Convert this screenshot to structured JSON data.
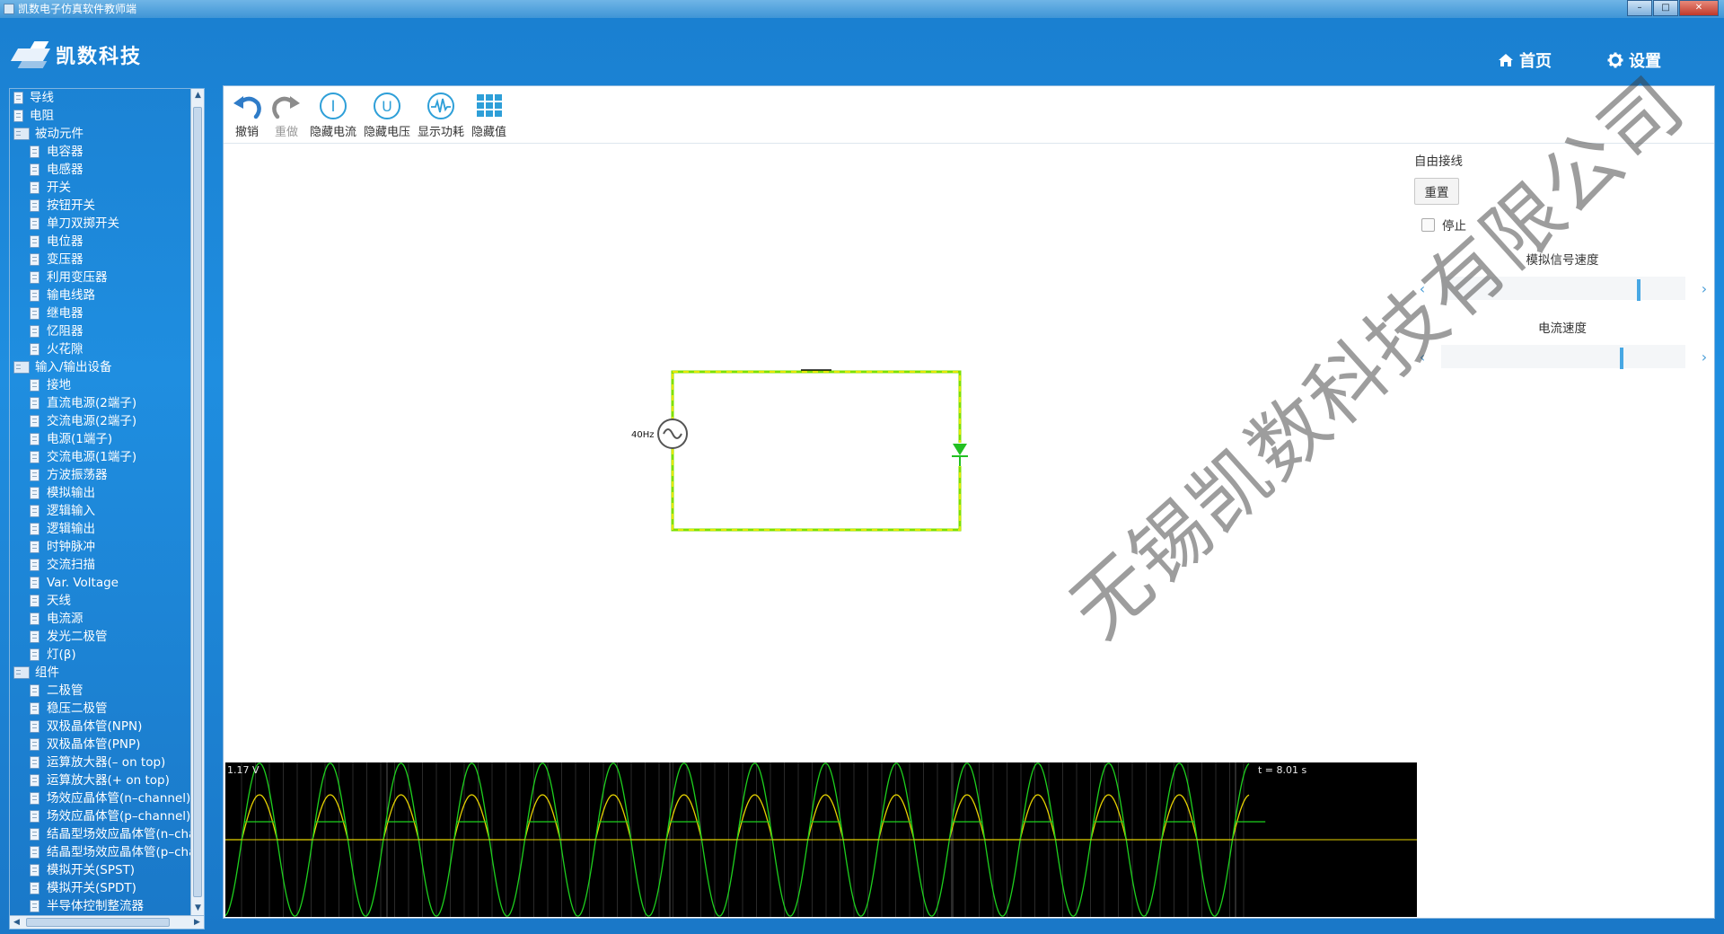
{
  "window": {
    "title": "凯数电子仿真软件教师端",
    "btn_min": "–",
    "btn_max": "□",
    "btn_close": "✕"
  },
  "header": {
    "logo_text": "凯数科技",
    "nav_home": "首页",
    "nav_settings": "设置"
  },
  "tree": {
    "items": [
      {
        "label": "导线",
        "level": 0,
        "folder": false
      },
      {
        "label": "电阻",
        "level": 0,
        "folder": false
      },
      {
        "label": "被动元件",
        "level": 0,
        "folder": true
      },
      {
        "label": "电容器",
        "level": 1,
        "folder": false
      },
      {
        "label": "电感器",
        "level": 1,
        "folder": false
      },
      {
        "label": "开关",
        "level": 1,
        "folder": false
      },
      {
        "label": "按钮开关",
        "level": 1,
        "folder": false
      },
      {
        "label": "单刀双掷开关",
        "level": 1,
        "folder": false
      },
      {
        "label": "电位器",
        "level": 1,
        "folder": false
      },
      {
        "label": "变压器",
        "level": 1,
        "folder": false
      },
      {
        "label": "利用变压器",
        "level": 1,
        "folder": false
      },
      {
        "label": "输电线路",
        "level": 1,
        "folder": false
      },
      {
        "label": "继电器",
        "level": 1,
        "folder": false
      },
      {
        "label": "忆阻器",
        "level": 1,
        "folder": false
      },
      {
        "label": "火花隙",
        "level": 1,
        "folder": false
      },
      {
        "label": "输入/输出设备",
        "level": 0,
        "folder": true
      },
      {
        "label": "接地",
        "level": 1,
        "folder": false
      },
      {
        "label": "直流电源(2端子)",
        "level": 1,
        "folder": false
      },
      {
        "label": "交流电源(2端子)",
        "level": 1,
        "folder": false
      },
      {
        "label": "电源(1端子)",
        "level": 1,
        "folder": false
      },
      {
        "label": "交流电源(1端子)",
        "level": 1,
        "folder": false
      },
      {
        "label": "方波振荡器",
        "level": 1,
        "folder": false
      },
      {
        "label": "模拟输出",
        "level": 1,
        "folder": false
      },
      {
        "label": "逻辑输入",
        "level": 1,
        "folder": false
      },
      {
        "label": "逻辑输出",
        "level": 1,
        "folder": false
      },
      {
        "label": "时钟脉冲",
        "level": 1,
        "folder": false
      },
      {
        "label": "交流扫描",
        "level": 1,
        "folder": false
      },
      {
        "label": "Var. Voltage",
        "level": 1,
        "folder": false
      },
      {
        "label": "天线",
        "level": 1,
        "folder": false
      },
      {
        "label": "电流源",
        "level": 1,
        "folder": false
      },
      {
        "label": "发光二极管",
        "level": 1,
        "folder": false
      },
      {
        "label": "灯(β)",
        "level": 1,
        "folder": false
      },
      {
        "label": "组件",
        "level": 0,
        "folder": true
      },
      {
        "label": "二极管",
        "level": 1,
        "folder": false
      },
      {
        "label": "稳压二极管",
        "level": 1,
        "folder": false
      },
      {
        "label": "双极晶体管(NPN)",
        "level": 1,
        "folder": false
      },
      {
        "label": "双极晶体管(PNP)",
        "level": 1,
        "folder": false
      },
      {
        "label": "运算放大器(– on top)",
        "level": 1,
        "folder": false
      },
      {
        "label": "运算放大器(+ on top)",
        "level": 1,
        "folder": false
      },
      {
        "label": "场效应晶体管(n–channel)",
        "level": 1,
        "folder": false
      },
      {
        "label": "场效应晶体管(p–channel)",
        "level": 1,
        "folder": false
      },
      {
        "label": "结晶型场效应晶体管(n–chan",
        "level": 1,
        "folder": false
      },
      {
        "label": "结晶型场效应晶体管(p–chan",
        "level": 1,
        "folder": false
      },
      {
        "label": "模拟开关(SPST)",
        "level": 1,
        "folder": false
      },
      {
        "label": "模拟开关(SPDT)",
        "level": 1,
        "folder": false
      },
      {
        "label": "半导体控制整流器",
        "level": 1,
        "folder": false
      }
    ]
  },
  "toolbar": {
    "undo": "撤销",
    "redo": "重做",
    "hide_current": "隐藏电流",
    "hide_voltage": "隐藏电压",
    "show_power": "显示功耗",
    "hide_values": "隐藏值",
    "icon_current_letter": "I",
    "icon_voltage_letter": "U"
  },
  "circuit": {
    "source_label": "40Hz"
  },
  "controls": {
    "title": "自由接线",
    "reset": "重置",
    "stop": "停止",
    "stop_checked": false,
    "signal_speed_label": "模拟信号速度",
    "signal_speed_value": 0.8,
    "current_speed_label": "电流速度",
    "current_speed_value": 0.73
  },
  "scope": {
    "voltage_label": "1.17 V",
    "time_label": "t = 8.01 s"
  },
  "watermark": "无锡凯数科技有限公司",
  "colors": {
    "wire": "#7de000",
    "dash": "#e6e600",
    "trace_yellow": "#e6d200",
    "trace_green": "#1ed01e",
    "accent": "#47a7e3"
  }
}
